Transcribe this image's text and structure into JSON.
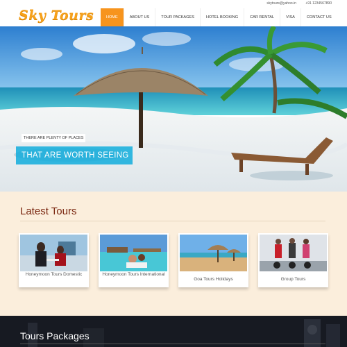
{
  "header": {
    "logo_text": "Sky Tours",
    "email": "skytours@yahoo.in",
    "phone": "+91 1234567890",
    "nav": [
      {
        "label": "HOME",
        "active": true
      },
      {
        "label": "ABOUT US"
      },
      {
        "label": "TOUR PACKAGES"
      },
      {
        "label": "HOTEL BOOKING"
      },
      {
        "label": "CAR RENTAL"
      },
      {
        "label": "VISA"
      },
      {
        "label": "CONTACT US"
      }
    ]
  },
  "hero": {
    "tagline": "THERE ARE PLENTY OF PLACES",
    "headline": "THAT ARE WORTH SEEING"
  },
  "latest_tours": {
    "title": "Latest Tours",
    "cards": [
      {
        "label": "Honeymoon Tours Domestic",
        "icon": "couple-dining-photo"
      },
      {
        "label": "Honeymoon Tours International",
        "icon": "couple-overwater-photo"
      },
      {
        "label": "Goa Tours Holidays",
        "icon": "beach-umbrella-photo"
      },
      {
        "label": "Group Tours",
        "icon": "segway-group-photo"
      }
    ]
  },
  "packages": {
    "title": "Tours Packages"
  },
  "colors": {
    "accent": "#f7941d",
    "hero_banner": "#11addc",
    "section_title": "#7a2710",
    "section_bg": "#fbeedc"
  }
}
